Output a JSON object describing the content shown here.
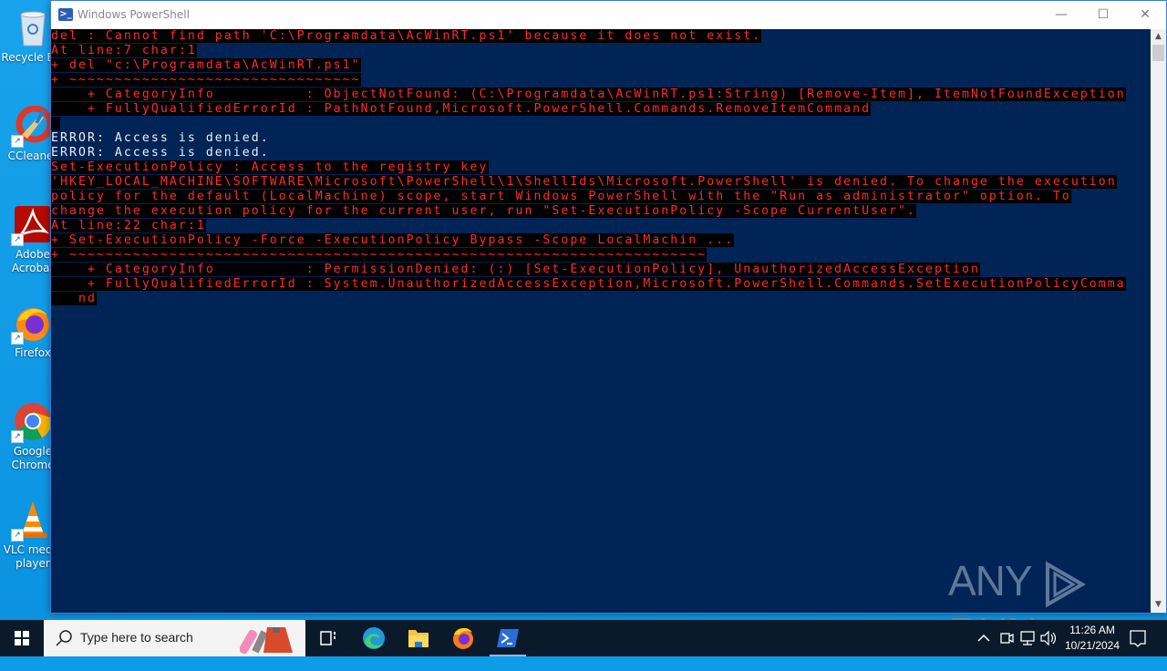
{
  "desktop": {
    "icons": [
      {
        "name": "recycle-bin",
        "label": "Recycle Bin"
      },
      {
        "name": "ccleaner",
        "label": "CCleaner"
      },
      {
        "name": "adobe-acrobat",
        "label": "Adobe Acrobat"
      },
      {
        "name": "firefox",
        "label": "Firefox"
      },
      {
        "name": "google-chrome",
        "label": "Google Chrome"
      },
      {
        "name": "vlc-media-player",
        "label": "VLC media player"
      }
    ]
  },
  "window": {
    "title": "Windows PowerShell",
    "minimize_glyph": "—",
    "maximize_glyph": "☐",
    "close_glyph": "✕"
  },
  "console": {
    "lines": [
      {
        "text": "del : Cannot find path 'C:\\Programdata\\AcWinRT.ps1' because it does not exist.",
        "style": "err"
      },
      {
        "text": "At line:7 char:1",
        "style": "err"
      },
      {
        "text": "+ del \"c:\\Programdata\\AcWinRT.ps1\"",
        "style": "err"
      },
      {
        "text": "+ ~~~~~~~~~~~~~~~~~~~~~~~~~~~~~~~~",
        "style": "err"
      },
      {
        "text": "    + CategoryInfo          : ObjectNotFound: (C:\\Programdata\\AcWinRT.ps1:String) [Remove-Item], ItemNotFoundException",
        "style": "err"
      },
      {
        "text": "    + FullyQualifiedErrorId : PathNotFound,Microsoft.PowerShell.Commands.RemoveItemCommand",
        "style": "err"
      },
      {
        "text": " ",
        "style": "err"
      },
      {
        "text": "ERROR: Access is denied.",
        "style": "wht"
      },
      {
        "text": "ERROR: Access is denied.",
        "style": "wht"
      },
      {
        "text": "Set-ExecutionPolicy : Access to the registry key",
        "style": "err"
      },
      {
        "text": "'HKEY_LOCAL_MACHINE\\SOFTWARE\\Microsoft\\PowerShell\\1\\ShellIds\\Microsoft.PowerShell' is denied. To change the execution",
        "style": "err"
      },
      {
        "text": "policy for the default (LocalMachine) scope, start Windows PowerShell with the \"Run as administrator\" option. To",
        "style": "err"
      },
      {
        "text": "change the execution policy for the current user, run \"Set-ExecutionPolicy -Scope CurrentUser\".",
        "style": "err"
      },
      {
        "text": "At line:22 char:1",
        "style": "err"
      },
      {
        "text": "+ Set-ExecutionPolicy -Force -ExecutionPolicy Bypass -Scope LocalMachin ...",
        "style": "err"
      },
      {
        "text": "+ ~~~~~~~~~~~~~~~~~~~~~~~~~~~~~~~~~~~~~~~~~~~~~~~~~~~~~~~~~~~~~~~~~~~~~~",
        "style": "err"
      },
      {
        "text": "    + CategoryInfo          : PermissionDenied: (:) [Set-ExecutionPolicy], UnauthorizedAccessException",
        "style": "err"
      },
      {
        "text": "    + FullyQualifiedErrorId : System.UnauthorizedAccessException,Microsoft.PowerShell.Commands.SetExecutionPolicyComma",
        "style": "err"
      },
      {
        "text": "   nd",
        "style": "err"
      }
    ]
  },
  "watermark": {
    "left": "ANY",
    "right": "RUN"
  },
  "taskbar": {
    "search_placeholder": "Type here to search",
    "apps": [
      {
        "name": "task-view",
        "label": "Task View"
      },
      {
        "name": "microsoft-edge",
        "label": "Microsoft Edge"
      },
      {
        "name": "file-explorer",
        "label": "File Explorer"
      },
      {
        "name": "firefox",
        "label": "Firefox"
      },
      {
        "name": "windows-powershell",
        "label": "Windows PowerShell",
        "active": true
      }
    ],
    "clock_time": "11:26 AM",
    "clock_date": "10/21/2024"
  },
  "colors": {
    "console_bg": "#012456",
    "error_fg": "#ff2b2b",
    "error_bg": "#000000",
    "output_fg": "#eeeeee"
  }
}
